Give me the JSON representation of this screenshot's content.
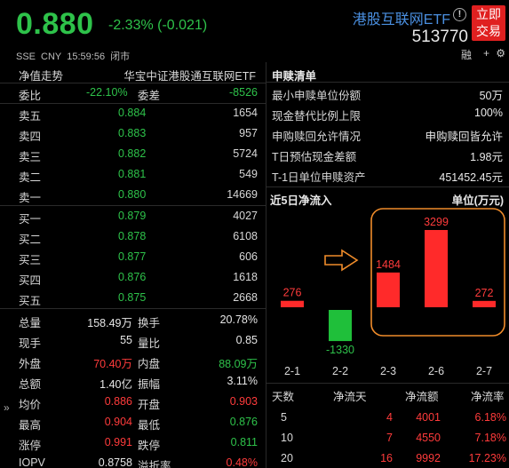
{
  "header": {
    "price": "0.880",
    "change": "-2.33% (-0.021)",
    "fund_name": "港股互联网ETF",
    "info_icon": "!",
    "code": "513770",
    "trade_button": "立即\n交易",
    "trade_line1": "立即",
    "trade_line2": "交易",
    "exchange": "SSE",
    "currency": "CNY",
    "time": "15:59:56",
    "status": "闭市",
    "icon1": "融",
    "icon2": "+",
    "icon3": "⚙"
  },
  "left": {
    "title": "净值走势",
    "index_name": "华宝中证港股通互联网ETF",
    "weibi": {
      "label": "委比",
      "value": "-22.10%",
      "label2": "委差",
      "value2": "-8526"
    },
    "sells": [
      {
        "label": "卖五",
        "price": "0.884",
        "vol": "1654"
      },
      {
        "label": "卖四",
        "price": "0.883",
        "vol": "957"
      },
      {
        "label": "卖三",
        "price": "0.882",
        "vol": "5724"
      },
      {
        "label": "卖二",
        "price": "0.881",
        "vol": "549"
      },
      {
        "label": "卖一",
        "price": "0.880",
        "vol": "14669"
      }
    ],
    "buys": [
      {
        "label": "买一",
        "price": "0.879",
        "vol": "4027"
      },
      {
        "label": "买二",
        "price": "0.878",
        "vol": "6108"
      },
      {
        "label": "买三",
        "price": "0.877",
        "vol": "606"
      },
      {
        "label": "买四",
        "price": "0.876",
        "vol": "1618"
      },
      {
        "label": "买五",
        "price": "0.875",
        "vol": "2668"
      }
    ],
    "stats": [
      {
        "l1": "总量",
        "v1": "158.49万",
        "l2": "换手",
        "v2": "20.78%",
        "c1": "white",
        "c2": "white"
      },
      {
        "l1": "现手",
        "v1": "55",
        "l2": "量比",
        "v2": "0.85",
        "c1": "white",
        "c2": "white"
      },
      {
        "l1": "外盘",
        "v1": "70.40万",
        "l2": "内盘",
        "v2": "88.09万",
        "c1": "up",
        "c2": "down"
      },
      {
        "l1": "总额",
        "v1": "1.40亿",
        "l2": "振幅",
        "v2": "3.11%",
        "c1": "white",
        "c2": "white"
      },
      {
        "l1": "均价",
        "v1": "0.886",
        "l2": "开盘",
        "v2": "0.903",
        "c1": "up",
        "c2": "up"
      },
      {
        "l1": "最高",
        "v1": "0.904",
        "l2": "最低",
        "v2": "0.876",
        "c1": "up",
        "c2": "down"
      },
      {
        "l1": "涨停",
        "v1": "0.991",
        "l2": "跌停",
        "v2": "0.811",
        "c1": "up",
        "c2": "down"
      },
      {
        "l1": "IOPV",
        "v1": "0.8758",
        "l2": "溢折率",
        "v2": "0.48%",
        "c1": "white",
        "c2": "up"
      }
    ],
    "expand_icon": "»"
  },
  "right": {
    "title": "申赎清单",
    "items": [
      {
        "k": "最小申赎单位份额",
        "v": "50万"
      },
      {
        "k": "现金替代比例上限",
        "v": "100%"
      },
      {
        "k": "申购赎回允许情况",
        "v": "申购赎回皆允许"
      },
      {
        "k": "T日预估现金差额",
        "v": "1.98元"
      },
      {
        "k": "T-1日单位申赎资产",
        "v": "451452.45元"
      }
    ],
    "flow_title": "近5日净流入",
    "unit": "单位(万元)",
    "table_headers": [
      "天数",
      "净流天",
      "净流额",
      "净流率"
    ],
    "table_rows": [
      {
        "d": "5",
        "n": "4",
        "amt": "4001",
        "rate": "6.18%"
      },
      {
        "d": "10",
        "n": "7",
        "amt": "4550",
        "rate": "7.18%"
      },
      {
        "d": "20",
        "n": "16",
        "amt": "9992",
        "rate": "17.23%"
      }
    ]
  },
  "chart_data": {
    "type": "bar",
    "title": "近5日净流入",
    "ylabel": "单位(万元)",
    "categories": [
      "2-1",
      "2-2",
      "2-3",
      "2-6",
      "2-7"
    ],
    "values": [
      276,
      -1330,
      1484,
      3299,
      272
    ],
    "labels": [
      "276",
      "-1330",
      "1484",
      "3299",
      "272"
    ],
    "colors": {
      "positive": "#ff2a2a",
      "negative": "#1fbf3a"
    },
    "annotation": "orange rounded box highlighting 2-3, 2-6, 2-7 with arrow"
  }
}
